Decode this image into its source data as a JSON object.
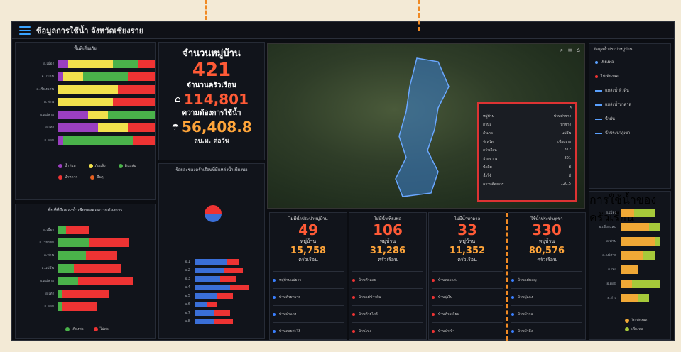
{
  "header": {
    "title": "ข้อมูลการใช้น้ำ จังหวัดเชียงราย"
  },
  "left_top": {
    "title": "พื้นที่เสี่ยงภัย",
    "rows": [
      {
        "label": "อ.เมือง",
        "segments": [
          {
            "c": "#9b3fc0",
            "v": 10
          },
          {
            "c": "#f2e14c",
            "v": 45
          },
          {
            "c": "#4ab24a",
            "v": 25
          },
          {
            "c": "#e33",
            "v": 20
          }
        ]
      },
      {
        "label": "อ.แม่จัน",
        "segments": [
          {
            "c": "#9b3fc0",
            "v": 5
          },
          {
            "c": "#f2e14c",
            "v": 20
          },
          {
            "c": "#4ab24a",
            "v": 45
          },
          {
            "c": "#e33",
            "v": 30
          }
        ]
      },
      {
        "label": "อ.เชียงแสน",
        "segments": [
          {
            "c": "#f2e14c",
            "v": 60
          },
          {
            "c": "#e33",
            "v": 40
          }
        ]
      },
      {
        "label": "อ.พาน",
        "segments": [
          {
            "c": "#f2e14c",
            "v": 55
          },
          {
            "c": "#e33",
            "v": 45
          }
        ]
      },
      {
        "label": "อ.แม่สาย",
        "segments": [
          {
            "c": "#9b3fc0",
            "v": 30
          },
          {
            "c": "#f2e14c",
            "v": 20
          },
          {
            "c": "#4ab24a",
            "v": 48
          },
          {
            "c": "#e33",
            "v": 2
          }
        ]
      },
      {
        "label": "อ.เทิง",
        "segments": [
          {
            "c": "#9b3fc0",
            "v": 40
          },
          {
            "c": "#f2e14c",
            "v": 30
          },
          {
            "c": "#e33",
            "v": 30
          }
        ]
      },
      {
        "label": "อ.ดอย",
        "segments": [
          {
            "c": "#9b3fc0",
            "v": 5
          },
          {
            "c": "#4ab24a",
            "v": 70
          },
          {
            "c": "#e33",
            "v": 25
          }
        ]
      }
    ],
    "legend": [
      {
        "label": "น้ำท่วม",
        "color": "#9b3fc0"
      },
      {
        "label": "ภัยแล้ง",
        "color": "#f2e14c"
      },
      {
        "label": "ดินถล่ม",
        "color": "#4ab24a"
      },
      {
        "label": "น้ำหลาก",
        "color": "#e33"
      },
      {
        "label": "อื่นๆ",
        "color": "#e66020"
      }
    ]
  },
  "left_bottom": {
    "title": "พื้นที่ที่มีแหล่งน้ำเพียงพอต่อความต้องการ",
    "rows": [
      {
        "label": "อ.เมือง",
        "g": 10,
        "r": 30
      },
      {
        "label": "อ.เวียงชัย",
        "g": 40,
        "r": 50
      },
      {
        "label": "อ.พาน",
        "g": 35,
        "r": 40
      },
      {
        "label": "อ.แม่จัน",
        "g": 20,
        "r": 60
      },
      {
        "label": "อ.แม่สาย",
        "g": 25,
        "r": 70
      },
      {
        "label": "อ.เทิง",
        "g": 5,
        "r": 60
      },
      {
        "label": "อ.ดอย",
        "g": 5,
        "r": 45
      }
    ],
    "legend": [
      {
        "label": "เพียงพอ",
        "color": "#4ab24a"
      },
      {
        "label": "ไม่พอ",
        "color": "#e33"
      }
    ]
  },
  "center_stats": {
    "villages_label": "จำนวนหมู่บ้าน",
    "villages": "421",
    "households_label": "จำนวนครัวเรือน",
    "households": "114,801",
    "usage_label": "ความต้องการใช้น้ำ",
    "usage": "56,408.8",
    "usage_unit": "ลบ.ม. ต่อวัน"
  },
  "pie_panel": {
    "title": "ร้อยละของครัวเรือนที่มีแหล่งน้ำเพียงพอ",
    "rows": [
      {
        "label": "อ.1",
        "b": 50,
        "r": 20
      },
      {
        "label": "อ.2",
        "b": 45,
        "r": 30
      },
      {
        "label": "อ.3",
        "b": 40,
        "r": 25
      },
      {
        "label": "อ.4",
        "b": 55,
        "r": 30
      },
      {
        "label": "อ.5",
        "b": 35,
        "r": 25
      },
      {
        "label": "อ.6",
        "b": 20,
        "r": 15
      },
      {
        "label": "อ.7",
        "b": 30,
        "r": 25
      },
      {
        "label": "อ.8",
        "b": 30,
        "r": 30
      }
    ]
  },
  "map_popup": {
    "rows": [
      {
        "k": "หมู่บ้าน",
        "v": "บ้านป่าซาง"
      },
      {
        "k": "ตำบล",
        "v": "ป่าซาง"
      },
      {
        "k": "อำเภอ",
        "v": "แม่จัน"
      },
      {
        "k": "จังหวัด",
        "v": "เชียงราย"
      },
      {
        "k": "ครัวเรือน",
        "v": "312"
      },
      {
        "k": "ประชากร",
        "v": "801"
      },
      {
        "k": "น้ำดื่ม",
        "v": "มี"
      },
      {
        "k": "น้ำใช้",
        "v": "มี"
      },
      {
        "k": "ความต้องการ",
        "v": "120.5"
      }
    ]
  },
  "kpis": [
    {
      "head": "ไม่มีน้ำประปาหมู่บ้าน",
      "num": "49",
      "unit": "หมู่บ้าน",
      "num2": "15,758",
      "unit2": "ครัวเรือน",
      "items": [
        "หมู่บ้านแม่ยาว",
        "บ้านห้วยทราย",
        "บ้านป่าแดง",
        "บ้านดอยสะโง้"
      ],
      "dot": "#3a7fff"
    },
    {
      "head": "ไม่มีน้ำเพียงพอ",
      "num": "106",
      "unit": "หมู่บ้าน",
      "num2": "31,286",
      "unit2": "ครัวเรือน",
      "items": [
        "บ้านหัวดอย",
        "บ้านแม่ข้าวต้ม",
        "บ้านห้วยไคร้",
        "บ้านโป่ง"
      ],
      "dot": "#e33"
    },
    {
      "head": "ไม่มีน้ำบาดาล",
      "num": "33",
      "unit": "หมู่บ้าน",
      "num2": "11,352",
      "unit2": "ครัวเรือน",
      "items": [
        "บ้านดอยแสง",
        "บ้านปูเงิน",
        "บ้านห้วยเคียน",
        "บ้านป่าเป้า"
      ],
      "dot": "#e33"
    },
    {
      "head": "ใช้น้ำประปาภูเขา",
      "num": "330",
      "unit": "หมู่บ้าน",
      "num2": "80,576",
      "unit2": "ครัวเรือน",
      "items": [
        "บ้านแม่มอญ",
        "บ้านปูแกง",
        "บ้านป่าก่อ",
        "บ้านป่าตึง"
      ],
      "dot": "#3a7fff"
    }
  ],
  "right_panel": {
    "title": "ข้อมูลน้ำประปาหมู่บ้าน",
    "items": [
      "เพียงพอ",
      "ไม่เพียงพอ",
      "แหล่งน้ำผิวดิน",
      "แหล่งน้ำบาดาล",
      "น้ำฝน",
      "น้ำประปาภูเขา"
    ]
  },
  "right_bars": {
    "title": "การใช้น้ำของครัวเรือน",
    "rows": [
      {
        "label": "อ.เมือง",
        "o": 12,
        "g": 18
      },
      {
        "label": "อ.เชียงแสน",
        "o": 25,
        "g": 10
      },
      {
        "label": "อ.พาน",
        "o": 30,
        "g": 5
      },
      {
        "label": "อ.แม่สาย",
        "o": 20,
        "g": 10
      },
      {
        "label": "อ.เทิง",
        "o": 15,
        "g": 0
      },
      {
        "label": "อ.ดอย",
        "o": 10,
        "g": 25
      },
      {
        "label": "อ.ฝาง",
        "o": 15,
        "g": 10
      }
    ],
    "legend": [
      {
        "label": "ไม่เพียงพอ",
        "color": "#f0a836"
      },
      {
        "label": "เพียงพอ",
        "color": "#a6c93a"
      }
    ]
  }
}
